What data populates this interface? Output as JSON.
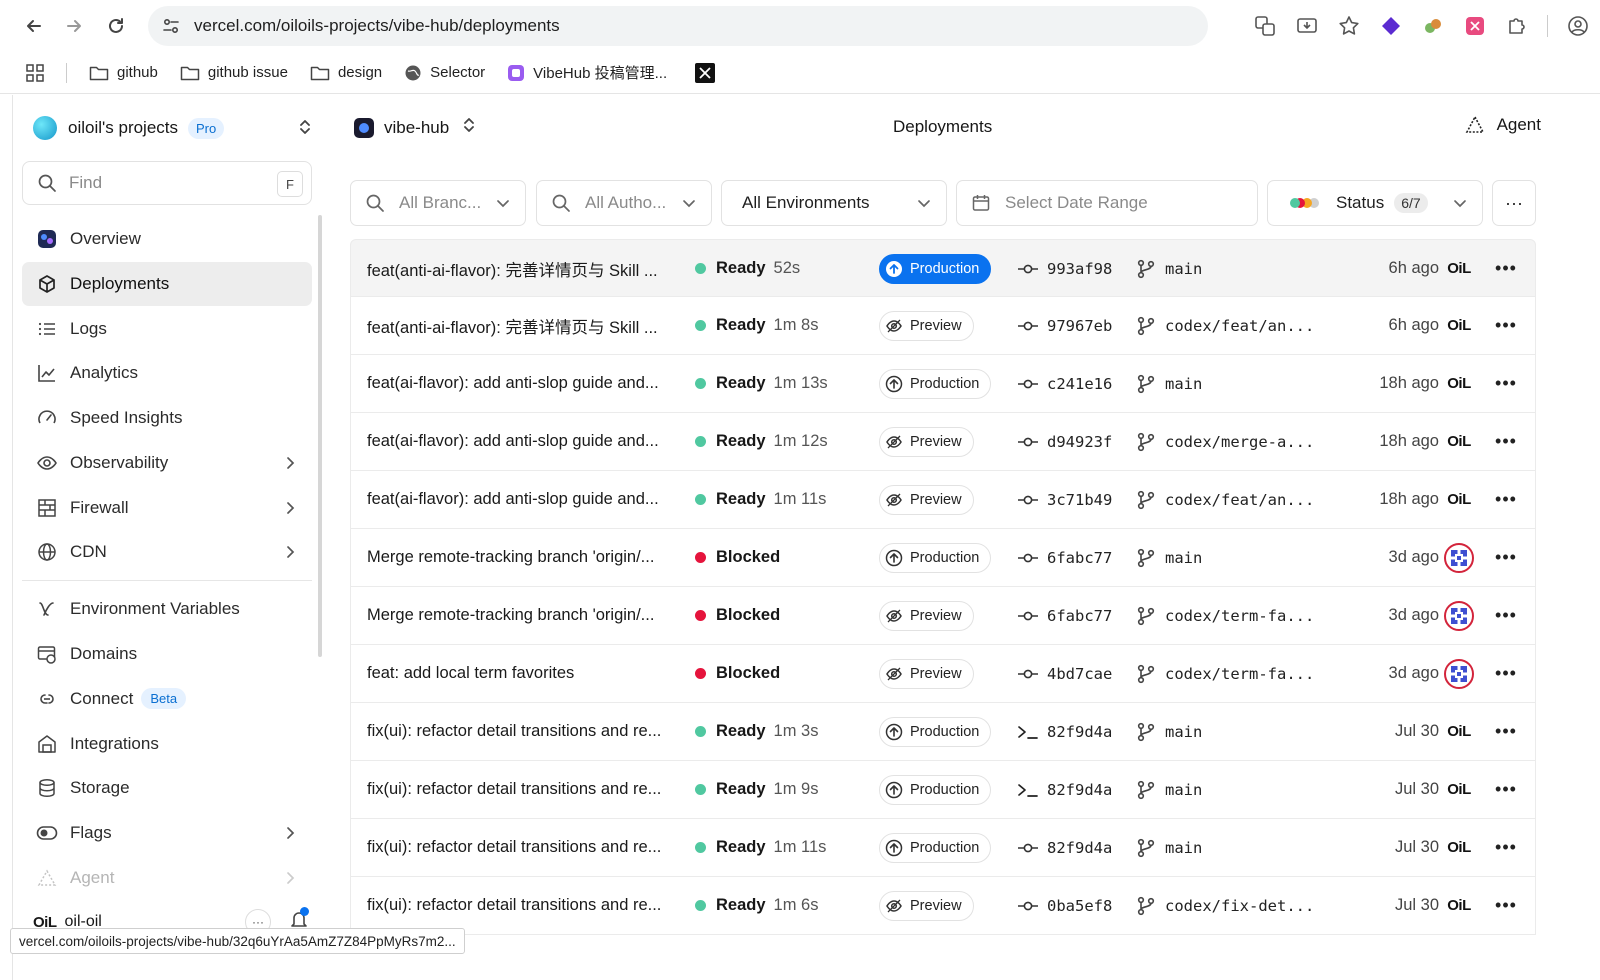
{
  "browser": {
    "url": "vercel.com/oiloils-projects/vibe-hub/deployments",
    "bookmarks": [
      "github",
      "github issue",
      "design",
      "Selector",
      "VibeHub 投稿管理..."
    ],
    "status_url": "vercel.com/oiloils-projects/vibe-hub/32q6uYrAa5AmZ7Z84PpMyRs7m2..."
  },
  "sidebar": {
    "team_name": "oiloil's projects",
    "team_plan": "Pro",
    "find_placeholder": "Find",
    "find_shortcut": "F",
    "items": [
      {
        "label": "Overview",
        "icon": "overview-icon"
      },
      {
        "label": "Deployments",
        "icon": "cube-icon",
        "active": true
      },
      {
        "label": "Logs",
        "icon": "list-icon"
      },
      {
        "label": "Analytics",
        "icon": "chart-icon"
      },
      {
        "label": "Speed Insights",
        "icon": "gauge-icon"
      },
      {
        "label": "Observability",
        "icon": "eye-icon",
        "chevron": true
      },
      {
        "label": "Firewall",
        "icon": "firewall-icon",
        "chevron": true
      },
      {
        "label": "CDN",
        "icon": "globe-icon",
        "chevron": true
      }
    ],
    "items2": [
      {
        "label": "Environment Variables",
        "icon": "variables-icon"
      },
      {
        "label": "Domains",
        "icon": "domain-icon"
      },
      {
        "label": "Connect",
        "icon": "connect-icon",
        "badge": "Beta"
      },
      {
        "label": "Integrations",
        "icon": "integrations-icon"
      },
      {
        "label": "Storage",
        "icon": "database-icon"
      },
      {
        "label": "Flags",
        "icon": "toggle-icon",
        "chevron": true
      },
      {
        "label": "Agent",
        "icon": "agent-icon",
        "chevron": true,
        "dim": true
      }
    ],
    "user_logo": "OiL",
    "user_name": "oil-oil",
    "user_more": "···"
  },
  "header": {
    "project_name": "vibe-hub",
    "page_title": "Deployments",
    "agent_label": "Agent"
  },
  "filters": {
    "branches_placeholder": "All Branc...",
    "authors_placeholder": "All Autho...",
    "environments": "All Environments",
    "date_placeholder": "Select Date Range",
    "status_label": "Status",
    "status_count": "6/7",
    "more": "···"
  },
  "deployments": [
    {
      "message": "feat(anti-ai-flavor): 完善详情页与 Skill ...",
      "status": "Ready",
      "duration": "52s",
      "env": "Production",
      "env_active": true,
      "commit": "993af98",
      "source": "git",
      "branch": "main",
      "time": "6h ago",
      "author": "oil"
    },
    {
      "message": "feat(anti-ai-flavor): 完善详情页与 Skill ...",
      "status": "Ready",
      "duration": "1m 8s",
      "env": "Preview",
      "commit": "97967eb",
      "source": "git",
      "branch": "codex/feat/an...",
      "time": "6h ago",
      "author": "oil"
    },
    {
      "message": "feat(ai-flavor): add anti-slop guide and...",
      "status": "Ready",
      "duration": "1m 13s",
      "env": "Production",
      "commit": "c241e16",
      "source": "git",
      "branch": "main",
      "time": "18h ago",
      "author": "oil"
    },
    {
      "message": "feat(ai-flavor): add anti-slop guide and...",
      "status": "Ready",
      "duration": "1m 12s",
      "env": "Preview",
      "commit": "d94923f",
      "source": "git",
      "branch": "codex/merge-a...",
      "time": "18h ago",
      "author": "oil"
    },
    {
      "message": "feat(ai-flavor): add anti-slop guide and...",
      "status": "Ready",
      "duration": "1m 11s",
      "env": "Preview",
      "commit": "3c71b49",
      "source": "git",
      "branch": "codex/feat/an...",
      "time": "18h ago",
      "author": "oil"
    },
    {
      "message": "Merge remote-tracking branch 'origin/...",
      "status": "Blocked",
      "duration": "",
      "env": "Production",
      "commit": "6fabc77",
      "source": "git",
      "branch": "main",
      "time": "3d ago",
      "author": "github"
    },
    {
      "message": "Merge remote-tracking branch 'origin/...",
      "status": "Blocked",
      "duration": "",
      "env": "Preview",
      "commit": "6fabc77",
      "source": "git",
      "branch": "codex/term-fa...",
      "time": "3d ago",
      "author": "github"
    },
    {
      "message": "feat: add local term favorites",
      "status": "Blocked",
      "duration": "",
      "env": "Preview",
      "commit": "4bd7cae",
      "source": "git",
      "branch": "codex/term-fa...",
      "time": "3d ago",
      "author": "github"
    },
    {
      "message": "fix(ui): refactor detail transitions and re...",
      "status": "Ready",
      "duration": "1m 3s",
      "env": "Production",
      "commit": "82f9d4a",
      "source": "cli",
      "branch": "main",
      "time": "Jul 30",
      "author": "oil"
    },
    {
      "message": "fix(ui): refactor detail transitions and re...",
      "status": "Ready",
      "duration": "1m 9s",
      "env": "Production",
      "commit": "82f9d4a",
      "source": "cli",
      "branch": "main",
      "time": "Jul 30",
      "author": "oil"
    },
    {
      "message": "fix(ui): refactor detail transitions and re...",
      "status": "Ready",
      "duration": "1m 11s",
      "env": "Production",
      "commit": "82f9d4a",
      "source": "git",
      "branch": "main",
      "time": "Jul 30",
      "author": "oil"
    },
    {
      "message": "fix(ui): refactor detail transitions and re...",
      "status": "Ready",
      "duration": "1m 6s",
      "env": "Preview",
      "commit": "0ba5ef8",
      "source": "git",
      "branch": "codex/fix-det...",
      "time": "Jul 30",
      "author": "oil"
    }
  ],
  "colors": {
    "ready": "#50c8a0",
    "blocked": "#e5143c",
    "accent": "#0a72ef"
  }
}
